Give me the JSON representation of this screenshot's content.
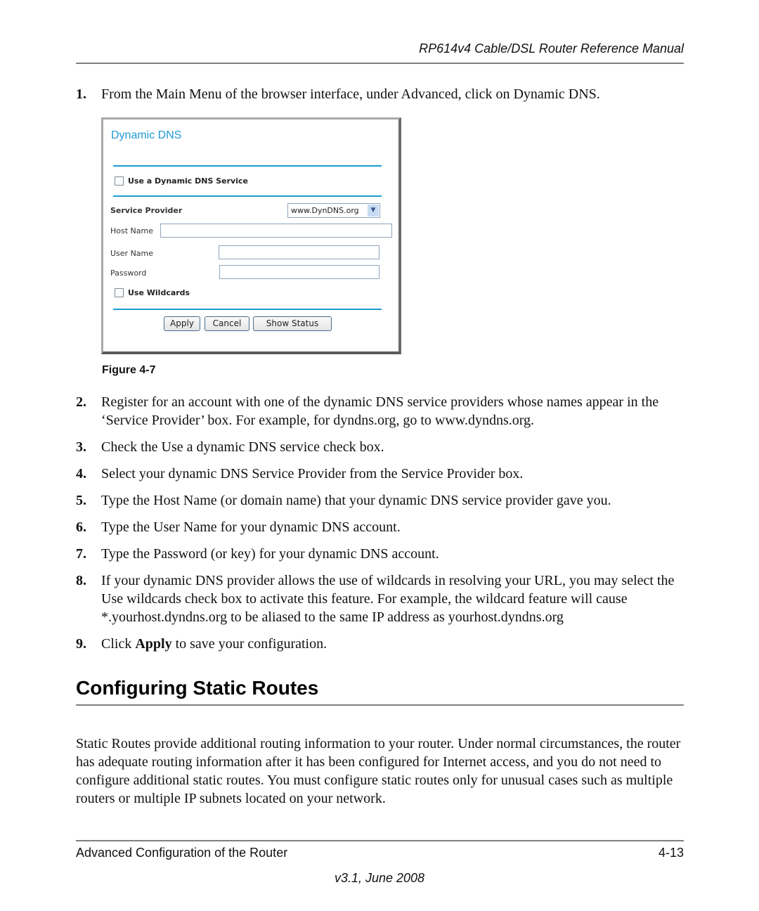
{
  "header": {
    "title": "RP614v4 Cable/DSL Router Reference Manual"
  },
  "steps": [
    {
      "num": "1.",
      "text": "From the Main Menu of the browser interface, under Advanced, click on Dynamic DNS."
    },
    {
      "num": "2.",
      "text": "Register for an account with one of the dynamic DNS service providers whose names appear in the ‘Service Provider’ box. For example, for dyndns.org, go to www.dyndns.org."
    },
    {
      "num": "3.",
      "text": "Check the Use a dynamic DNS service check box."
    },
    {
      "num": "4.",
      "text": "Select your dynamic DNS Service Provider from the Service Provider box."
    },
    {
      "num": "5.",
      "text": "Type the Host Name (or domain name) that your dynamic DNS service provider gave you."
    },
    {
      "num": "6.",
      "text": "Type the User Name for your dynamic DNS account."
    },
    {
      "num": "7.",
      "text": "Type the Password (or key) for your dynamic DNS account."
    },
    {
      "num": "8.",
      "text": "If your dynamic DNS provider allows the use of wildcards in resolving your URL, you may select the Use wildcards check box to activate this feature. For example, the wildcard feature will cause *.yourhost.dyndns.org to be aliased to the same IP address as yourhost.dyndns.org"
    },
    {
      "num": "9.",
      "text_before": "Click ",
      "text_bold": "Apply",
      "text_after": " to save your configuration."
    }
  ],
  "figure": {
    "caption": "Figure 4-7",
    "panel": {
      "title": "Dynamic DNS",
      "use_service_label": "Use a Dynamic DNS Service",
      "use_service_checked": false,
      "service_provider_label": "Service Provider",
      "service_provider_value": "www.DynDNS.org",
      "host_name_label": "Host Name",
      "host_name_value": "",
      "user_name_label": "User Name",
      "user_name_value": "",
      "password_label": "Password",
      "password_value": "",
      "use_wildcards_label": "Use Wildcards",
      "use_wildcards_checked": false,
      "buttons": {
        "apply": "Apply",
        "cancel": "Cancel",
        "show_status": "Show Status"
      },
      "accent_color": "#1a9ccf",
      "title_color": "#1f9ad4"
    }
  },
  "section": {
    "heading": "Configuring Static Routes",
    "paragraph": "Static Routes provide additional routing information to your router. Under normal circumstances, the router has adequate routing information after it has been configured for Internet access, and you do not need to configure additional static routes. You must configure static routes only for unusual cases such as multiple routers or multiple IP subnets located on your network."
  },
  "footer": {
    "chapter": "Advanced Configuration of the Router",
    "page": "4-13",
    "version": "v3.1, June 2008"
  }
}
